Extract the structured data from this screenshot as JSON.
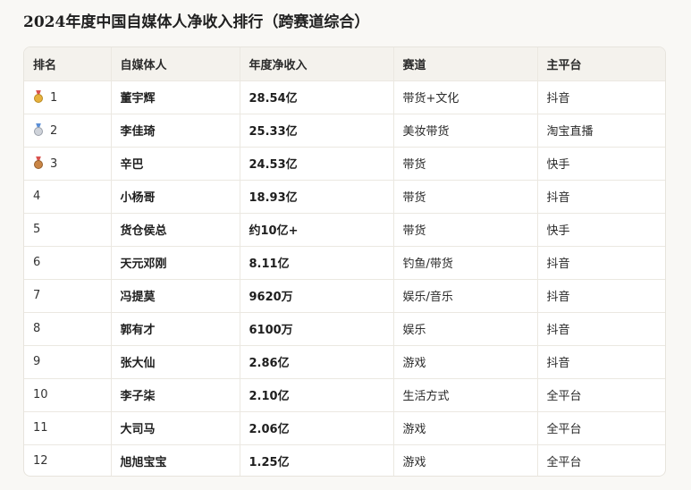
{
  "page": {
    "title": "2024年度中国自媒体人净收入排行（跨赛道综合）"
  },
  "table": {
    "headers": [
      "排名",
      "自媒体人",
      "年度净收入",
      "赛道",
      "主平台"
    ],
    "rows": [
      {
        "medal": "gold-medal",
        "rank": "1",
        "name": "董宇辉",
        "income": "28.54亿",
        "track": "带货+文化",
        "platform": "抖音"
      },
      {
        "medal": "silver-medal",
        "rank": "2",
        "name": "李佳琦",
        "income": "25.33亿",
        "track": "美妆带货",
        "platform": "淘宝直播"
      },
      {
        "medal": "bronze-medal",
        "rank": "3",
        "name": "辛巴",
        "income": "24.53亿",
        "track": "带货",
        "platform": "快手"
      },
      {
        "medal": "",
        "rank": "4",
        "name": "小杨哥",
        "income": "18.93亿",
        "track": "带货",
        "platform": "抖音"
      },
      {
        "medal": "",
        "rank": "5",
        "name": "货仓侯总",
        "income": "约10亿+",
        "track": "带货",
        "platform": "快手"
      },
      {
        "medal": "",
        "rank": "6",
        "name": "天元邓刚",
        "income": "8.11亿",
        "track": "钓鱼/带货",
        "platform": "抖音"
      },
      {
        "medal": "",
        "rank": "7",
        "name": "冯提莫",
        "income": "9620万",
        "track": "娱乐/音乐",
        "platform": "抖音"
      },
      {
        "medal": "",
        "rank": "8",
        "name": "郭有才",
        "income": "6100万",
        "track": "娱乐",
        "platform": "抖音"
      },
      {
        "medal": "",
        "rank": "9",
        "name": "张大仙",
        "income": "2.86亿",
        "track": "游戏",
        "platform": "抖音"
      },
      {
        "medal": "",
        "rank": "10",
        "name": "李子柒",
        "income": "2.10亿",
        "track": "生活方式",
        "platform": "全平台"
      },
      {
        "medal": "",
        "rank": "11",
        "name": "大司马",
        "income": "2.06亿",
        "track": "游戏",
        "platform": "全平台"
      },
      {
        "medal": "",
        "rank": "12",
        "name": "旭旭宝宝",
        "income": "1.25亿",
        "track": "游戏",
        "platform": "全平台"
      }
    ]
  }
}
